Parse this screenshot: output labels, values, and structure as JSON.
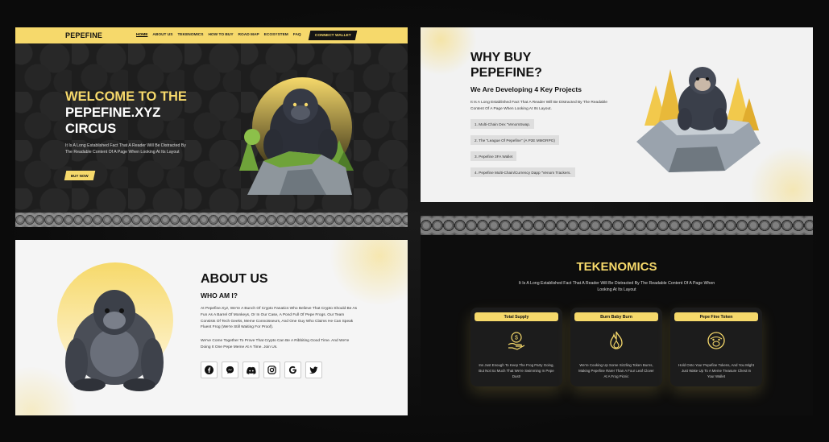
{
  "hero": {
    "logo": "PEPEFINE",
    "nav": [
      "HOME",
      "ABOUT US",
      "TEKENOMICS",
      "HOW TO BUY",
      "ROAD MAP",
      "ECOSYSTEM",
      "FAQ"
    ],
    "connect_label": "CONNECT WALLET",
    "title_line1": "WELCOME TO THE",
    "title_line2": "PEPEFINE.XYZ",
    "title_line3": "CIRCUS",
    "text": "It Is A Long Established Fact That A Reader Will Be Distracted By The Readable Content Of A Page When Looking At Its Layout",
    "buy_label": "BUY NOW"
  },
  "why": {
    "title_line1": "WHY BUY",
    "title_line2": "PEPEFINE?",
    "subtitle": "We Are Developing 4 Key Projects",
    "desc": "It Is A Long Established Fact That A Reader Will Be Distracted By The Readable Content Of A Page When Looking At Its Layout.",
    "projects": [
      "1. Multi-Chain Dex \"VenomSwap.",
      "2. The \"League Of Pepefine\" (A P2E MMORPG)",
      "3.  Pepefine 3FA Wallet",
      "4. Pepefine Multi-Chain/Currency Dapp \"Venom Trackers."
    ]
  },
  "about": {
    "title": "ABOUT US",
    "who": "WHO AM I?",
    "p1": "At Pepefine.Xyz, We're A Bunch Of Crypto Fanatics Who Believe That Crypto Should Be As Fun As A Barrel Of Monkeys, Or In Our Case, A Pond Full Of Pepe Frogs. Our Team Consists Of Tech Geeks, Meme Connoisseurs, And One Guy Who Claims He Can Speak Fluent Frog (We're Still Waiting For Proof).",
    "p2": "We've Come Together To Prove That Crypto Can Be A Ribbiting Good Time. And We're Doing It One Pepe Meme At A Time. Join Us."
  },
  "tokenomics": {
    "title": "TEKENOMICS",
    "desc": "It Is A Long Established Fact That A Reader Will Be Distracted By The Readable Content Of A Page When Looking At Its Layout",
    "cards": [
      {
        "header": "Total Supply",
        "text": "Ins Just Enough To Keep The Frog Party Going, But Not So Much That We're Swimming In Pepe Dust!"
      },
      {
        "header": "Burn Baby Burn",
        "text": "We're Cooking Up Some Sizzling Token Burns, Making Pepefine Rarer Than A Four Leaf Clover At A Frog Picnic"
      },
      {
        "header": "Pepe Fine Token",
        "text": "Hold Onto Your Pepefine Tokens, And You Might Just Wake Up To A Meme Treasure Chest In Your Wallet"
      }
    ]
  },
  "colors": {
    "accent": "#f6d96b",
    "dark": "#111111",
    "light": "#f2f2f2"
  }
}
